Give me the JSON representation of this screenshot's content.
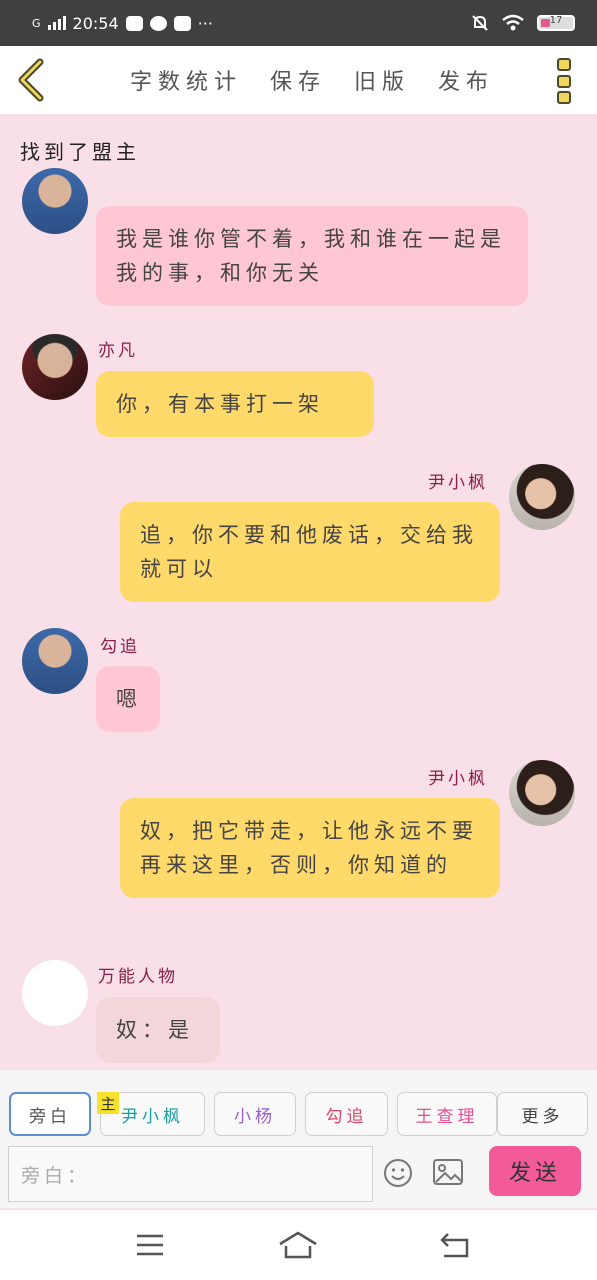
{
  "status_bar": {
    "time": "20:54",
    "network": "G",
    "more": "···",
    "battery_level": "17"
  },
  "toolbar": {
    "buttons": [
      "字数统计",
      "保存",
      "旧版",
      "发布"
    ]
  },
  "chat": {
    "title": "找到了盟主",
    "messages": [
      {
        "sender": "",
        "side": "left",
        "text": "我是谁你管不着，我和谁在一起是我的事，和你无关"
      },
      {
        "sender": "亦凡",
        "side": "left",
        "text": "你，有本事打一架"
      },
      {
        "sender": "尹小枫",
        "side": "right",
        "text": "追，你不要和他废话，交给我就可以"
      },
      {
        "sender": "勾追",
        "side": "left",
        "text": "嗯"
      },
      {
        "sender": "尹小枫",
        "side": "right",
        "text": "奴，把它带走，让他永远不要再来这里，否则，你知道的"
      },
      {
        "sender": "万能人物",
        "side": "left",
        "text": "奴：是"
      }
    ]
  },
  "roles": {
    "main_tag": "主",
    "items": [
      "旁白",
      "尹小枫",
      "小杨",
      "勾追",
      "王查理",
      "更多"
    ],
    "colors": [
      "#555555",
      "#1aa0a0",
      "#9a5fcf",
      "#e0486b",
      "#e05090",
      "#444444"
    ]
  },
  "input": {
    "placeholder": "旁白：",
    "send_label": "发送"
  },
  "colors": {
    "background": "#f9dfe7",
    "send": "#f25a98",
    "bubble_pink": "#ffc6d4",
    "bubble_yellow": "#ffda6b",
    "sender_name": "#8a1f4a"
  }
}
